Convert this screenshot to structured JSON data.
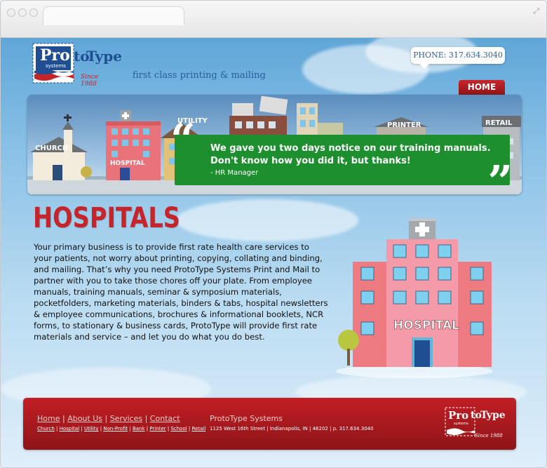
{
  "brand": {
    "logo_word_pro": "Pro",
    "logo_word_to": "to",
    "logo_word_type": "Type",
    "logo_sub": "systems",
    "logo_since": "Since 1988",
    "tagline": "first class printing & mailing"
  },
  "header": {
    "phone": "PHONE: 317.634.3040",
    "home_button": "HOME"
  },
  "banner": {
    "quote_line1": "We gave you two days notice on our training manuals.",
    "quote_line2": "Don't know how you did it, but thanks!",
    "quote_author": "- HR Manager",
    "labels": {
      "church": "CHURCH",
      "hospital": "HOSPITAL",
      "utility": "UTILITY",
      "printer": "PRINTER",
      "retail": "RETAIL"
    }
  },
  "main": {
    "title": "HOSPITALS",
    "paragraph": "Your primary business is to provide first rate health care services to your patients, not worry about printing, copying, collating and binding, and mailing. That’s why you need ProtoType Systems Print and Mail to partner with you to take those chores off your plate. From employee manuals, training manuals, seminar & symposium materials, pocketfolders, marketing materials, binders & tabs, hospital newsletters & employee communications, brochures & informational booklets, NCR forms, to stationary & business cards, ProtoType will provide first rate materials and service – and let you do what you do best.",
    "illustration_label": "HOSPITAL"
  },
  "footer": {
    "nav": [
      "Home",
      "About Us",
      "Services",
      "Contact"
    ],
    "sub_nav": [
      "Church",
      "Hospital",
      "Utility",
      "Non-Profit",
      "Bank",
      "Printer",
      "School",
      "Retail"
    ],
    "company": "ProtoType Systems",
    "address": "1125 West 16th Street | Indianapolis, IN | 46202 | p. 317.634.3040"
  },
  "colors": {
    "accent_red": "#c5242a",
    "brand_blue": "#2a5d9a",
    "quote_green": "#1d8f2f"
  }
}
